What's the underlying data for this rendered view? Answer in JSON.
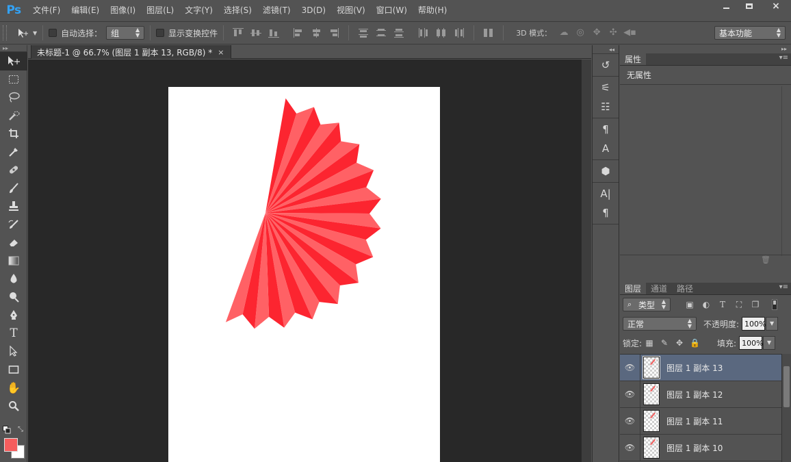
{
  "app": {
    "logo": "Ps"
  },
  "menu": [
    "文件(F)",
    "编辑(E)",
    "图像(I)",
    "图层(L)",
    "文字(Y)",
    "选择(S)",
    "滤镜(T)",
    "3D(D)",
    "视图(V)",
    "窗口(W)",
    "帮助(H)"
  ],
  "window_controls": {
    "close": "×"
  },
  "options": {
    "auto_select_label": "自动选择：",
    "auto_select_value": "组",
    "show_transform_label": "显示变换控件",
    "mode3d_label": "3D 模式：",
    "workspace": "基本功能"
  },
  "document": {
    "tab_title": "未标题-1 @ 66.7% (图层 1 副本 13, RGB/8) *",
    "tab_close": "×"
  },
  "colors": {
    "foreground": "#f55d5d",
    "background": "#ffffff",
    "fan_dark": "#fc2530",
    "fan_light": "#ff6165",
    "selected_layer_bg": "#5a687f"
  },
  "properties_panel": {
    "tab": "属性",
    "content": "无属性"
  },
  "layers_panel": {
    "tabs": [
      "图层",
      "通道",
      "路径"
    ],
    "filter_type": "类型",
    "blend_mode": "正常",
    "opacity_label": "不透明度:",
    "opacity_value": "100%",
    "lock_label": "锁定:",
    "fill_label": "填充:",
    "fill_value": "100%",
    "layers": [
      {
        "name": "图层 1 副本 13",
        "selected": true
      },
      {
        "name": "图层 1 副本 12",
        "selected": false
      },
      {
        "name": "图层 1 副本 11",
        "selected": false
      },
      {
        "name": "图层 1 副本 10",
        "selected": false
      }
    ]
  }
}
